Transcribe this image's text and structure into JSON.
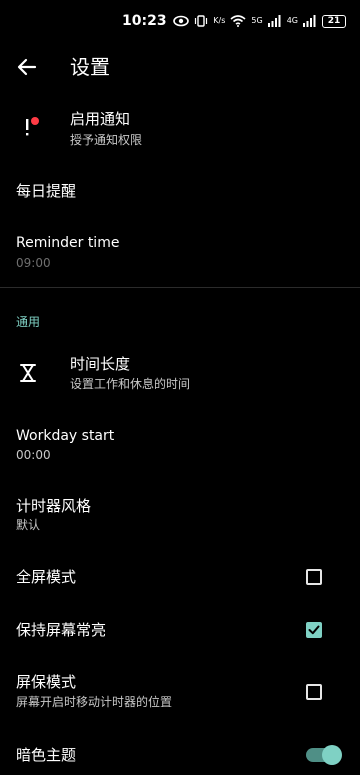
{
  "status_bar": {
    "time": "10:23",
    "speed_label": "K/s",
    "net1": "5G",
    "net2": "4G",
    "battery": "21"
  },
  "app_bar": {
    "title": "设置"
  },
  "notifications": {
    "title": "启用通知",
    "subtitle": "授予通知权限",
    "dot_color": "#ff3b45"
  },
  "daily_reminder": {
    "title": "每日提醒"
  },
  "reminder_time": {
    "title": "Reminder time",
    "value": "09:00"
  },
  "general_section": {
    "header": "通用"
  },
  "time_length": {
    "title": "时间长度",
    "subtitle": "设置工作和休息的时间"
  },
  "workday_start": {
    "title": "Workday start",
    "value": "00:00"
  },
  "timer_style": {
    "title": "计时器风格",
    "value": "默认"
  },
  "fullscreen": {
    "title": "全屏模式",
    "checked": false
  },
  "keep_screen_on": {
    "title": "保持屏幕常亮",
    "checked": true
  },
  "screensaver": {
    "title": "屏保模式",
    "subtitle": "屏幕开启时移动计时器的位置",
    "checked": false
  },
  "dark_theme": {
    "title": "暗色主题",
    "enabled": true
  },
  "colors": {
    "accent": "#7fd1c4",
    "background": "#000000"
  }
}
